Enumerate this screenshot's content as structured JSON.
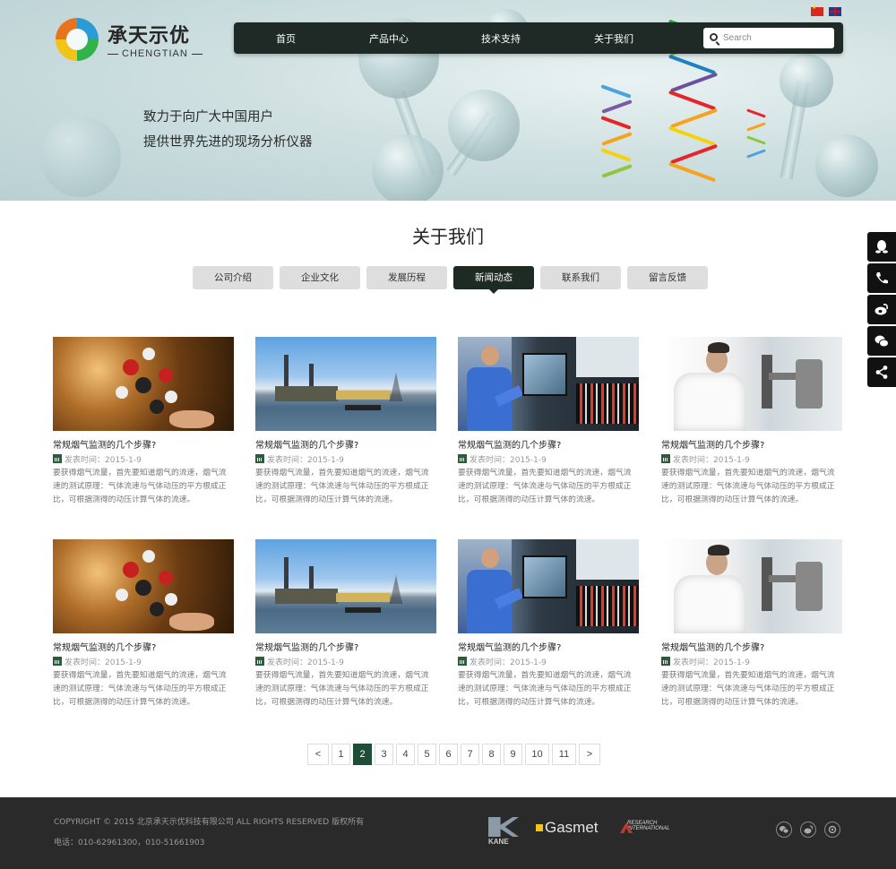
{
  "header": {
    "logo_cn": "承天示优",
    "logo_en": "CHENGTIAN",
    "nav": [
      "首页",
      "产品中心",
      "技术支持",
      "关于我们"
    ],
    "search_placeholder": "Search",
    "slogan_line1": "致力于向广大中国用户",
    "slogan_line2": "提供世界先进的现场分析仪器",
    "flags": [
      "cn-flag-icon",
      "uk-flag-icon"
    ]
  },
  "section": {
    "title": "关于我们",
    "tabs": [
      "公司介绍",
      "企业文化",
      "发展历程",
      "新闻动态",
      "联系我们",
      "留言反馈"
    ],
    "active_tab": "新闻动态"
  },
  "articles": [
    {
      "image": "molecule-hand",
      "title": "常规烟气监测的几个步骤?",
      "date": "发表时间：2015-1-9",
      "desc": "要获得烟气流量，首先要知道烟气的流速，烟气流速的测试原理：气体流速与气体动压的平方根成正比，可根据测得的动压计算气体的流速。"
    },
    {
      "image": "power-plant",
      "title": "常规烟气监测的几个步骤?",
      "date": "发表时间：2015-1-9",
      "desc": "要获得烟气流量，首先要知道烟气的流速，烟气流速的测试原理：气体流速与气体动压的平方根成正比，可根据测得的动压计算气体的流速。"
    },
    {
      "image": "engineer-panel",
      "title": "常规烟气监测的几个步骤?",
      "date": "发表时间：2015-1-9",
      "desc": "要获得烟气流量，首先要知道烟气的流速，烟气流速的测试原理：气体流速与气体动压的平方根成正比，可根据测得的动压计算气体的流速。"
    },
    {
      "image": "lab-scientist",
      "title": "常规烟气监测的几个步骤?",
      "date": "发表时间：2015-1-9",
      "desc": "要获得烟气流量，首先要知道烟气的流速，烟气流速的测试原理：气体流速与气体动压的平方根成正比，可根据测得的动压计算气体的流速。"
    },
    {
      "image": "molecule-hand",
      "title": "常规烟气监测的几个步骤?",
      "date": "发表时间：2015-1-9",
      "desc": "要获得烟气流量，首先要知道烟气的流速，烟气流速的测试原理：气体流速与气体动压的平方根成正比，可根据测得的动压计算气体的流速。"
    },
    {
      "image": "power-plant",
      "title": "常规烟气监测的几个步骤?",
      "date": "发表时间：2015-1-9",
      "desc": "要获得烟气流量，首先要知道烟气的流速，烟气流速的测试原理：气体流速与气体动压的平方根成正比，可根据测得的动压计算气体的流速。"
    },
    {
      "image": "engineer-panel",
      "title": "常规烟气监测的几个步骤?",
      "date": "发表时间：2015-1-9",
      "desc": "要获得烟气流量，首先要知道烟气的流速，烟气流速的测试原理：气体流速与气体动压的平方根成正比，可根据测得的动压计算气体的流速。"
    },
    {
      "image": "lab-scientist",
      "title": "常规烟气监测的几个步骤?",
      "date": "发表时间：2015-1-9",
      "desc": "要获得烟气流量，首先要知道烟气的流速，烟气流速的测试原理：气体流速与气体动压的平方根成正比，可根据测得的动压计算气体的流速。"
    }
  ],
  "pagination": {
    "prev": "<",
    "next": ">",
    "pages": [
      "1",
      "2",
      "3",
      "4",
      "5",
      "6",
      "7",
      "8",
      "9",
      "10",
      "11"
    ],
    "current": "2"
  },
  "side_tools": [
    "qq-icon",
    "phone-icon",
    "weibo-icon",
    "wechat-icon",
    "share-icon"
  ],
  "footer": {
    "copyright": "COPYRIGHT © 2015 北京承天示优科技有限公司 ALL RIGHTS RESERVED 版权所有",
    "phone": "电话：010-62961300，010-51661903",
    "partners": {
      "kane": "KANE",
      "gasmet": "Gasmet",
      "research_line1": "RESEARCH",
      "research_line2": "INTERNATIONAL"
    },
    "social": [
      "wechat-icon",
      "weibo-icon",
      "other-social-icon"
    ]
  },
  "colors": {
    "nav_bg": "#1f2a27",
    "active_tab": "#1e2b25",
    "pager_active": "#1f4d35",
    "footer_bg": "#2a2a2a"
  }
}
